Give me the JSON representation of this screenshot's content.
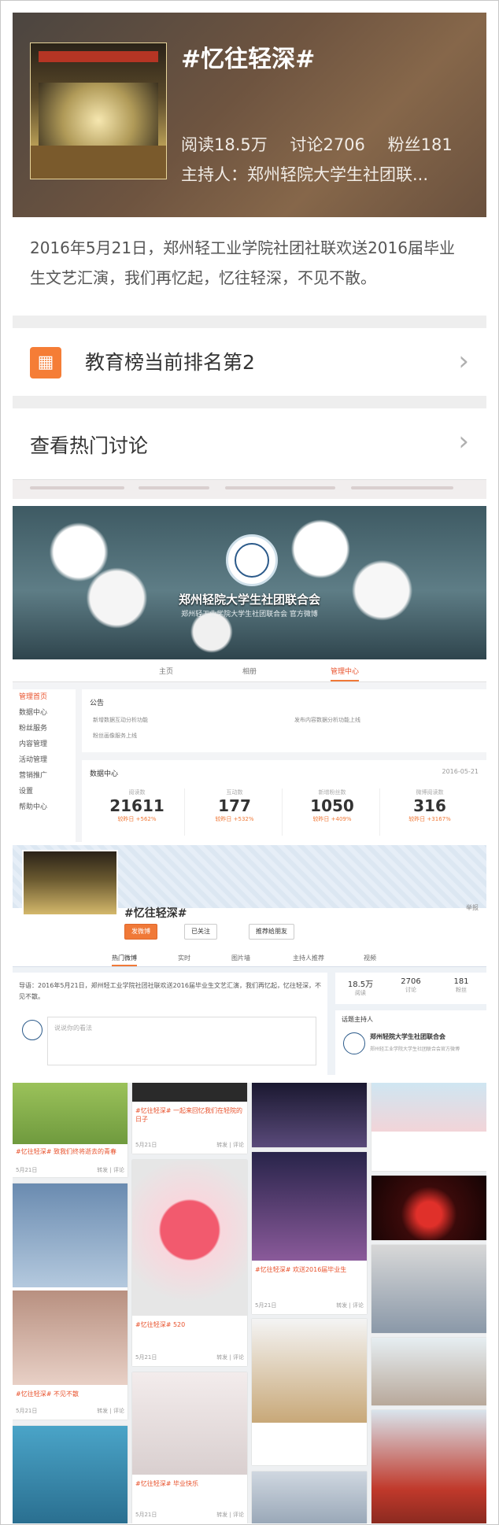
{
  "topic": {
    "title": "#忆往轻深#",
    "read": "阅读18.5万",
    "discuss": "讨论2706",
    "fans": "粉丝181",
    "host": "主持人：郑州轻院大学生社团联...",
    "description": "2016年5月21日，郑州轻工业学院社团社联欢送2016届毕业生文艺汇演，我们再忆起，忆往轻深，不见不散。",
    "rank_icon": "grid-icon",
    "rank_label": "教育榜当前排名第2",
    "hot_label": "查看热门讨论",
    "chevron": "›"
  },
  "profile": {
    "name": "郑州轻院大学生社团联合会",
    "sub": "郑州轻工业学院大学生社团联合会 官方微博",
    "tabs": [
      "主页",
      "相册",
      "管理中心"
    ],
    "side_menu": [
      "管理首页",
      "数据中心",
      "粉丝服务",
      "内容管理",
      "活动管理",
      "营销推广",
      "设置",
      "帮助中心"
    ],
    "notice_title": "公告",
    "notices": [
      "新增数据互动分析功能",
      "发布内容数据分析功能上线",
      "粉丝画像服务上线"
    ],
    "data_center": {
      "title": "数据中心",
      "date": "2016-05-21",
      "cells": [
        {
          "label": "阅读数",
          "value": "21611",
          "change": "较昨日 +562%"
        },
        {
          "label": "互动数",
          "value": "177",
          "change": "较昨日 +532%"
        },
        {
          "label": "新增粉丝数",
          "value": "1050",
          "change": "较昨日 +409%"
        },
        {
          "label": "微博阅读数",
          "value": "316",
          "change": "较昨日 +3167%"
        }
      ]
    }
  },
  "topic_page": {
    "title": "#忆往轻深#",
    "btn_post": "发微博",
    "btn_follow": "已关注",
    "btn_share": "推荐给朋友",
    "report": "举报",
    "tabs": [
      "热门微博",
      "实时",
      "图片墙",
      "主持人推荐",
      "视频"
    ],
    "intro": "导语：2016年5月21日，郑州轻工业学院社团社联欢送2016届毕业生文艺汇演，我们再忆起，忆往轻深，不见不散。",
    "compose_placeholder": "说说你的看法",
    "stats": [
      {
        "value": "18.5万",
        "label": "阅读"
      },
      {
        "value": "2706",
        "label": "讨论"
      },
      {
        "value": "181",
        "label": "粉丝"
      }
    ],
    "host_title": "话题主持人",
    "host_name": "郑州轻院大学生社团联合会",
    "host_sub": "郑州轻工业学院大学生社团联合会官方微博"
  },
  "wall": {
    "cards": [
      {
        "caption": "#忆往轻深# 致我们终将逝去的青春",
        "date": "5月21日",
        "acts": "转发 | 评论"
      },
      {
        "caption": "#忆往轻深# 一起来回忆我们在轻院的日子",
        "date": "5月21日",
        "acts": "转发 | 评论"
      },
      {
        "caption": "#忆往轻深# 欢送2016届毕业生",
        "date": "5月21日",
        "acts": "转发 | 评论"
      },
      {
        "caption": "#忆往轻深# 不见不散",
        "date": "5月21日",
        "acts": "转发 | 评论"
      },
      {
        "caption": "#忆往轻深# 520",
        "date": "5月21日",
        "acts": "转发 | 评论"
      },
      {
        "caption": "#忆往轻深# 毕业快乐",
        "date": "5月21日",
        "acts": "转发 | 评论"
      }
    ]
  },
  "colors": {
    "accent": "#f07938",
    "rank_icon_bg": "#f57d36",
    "link": "#e8512b"
  }
}
